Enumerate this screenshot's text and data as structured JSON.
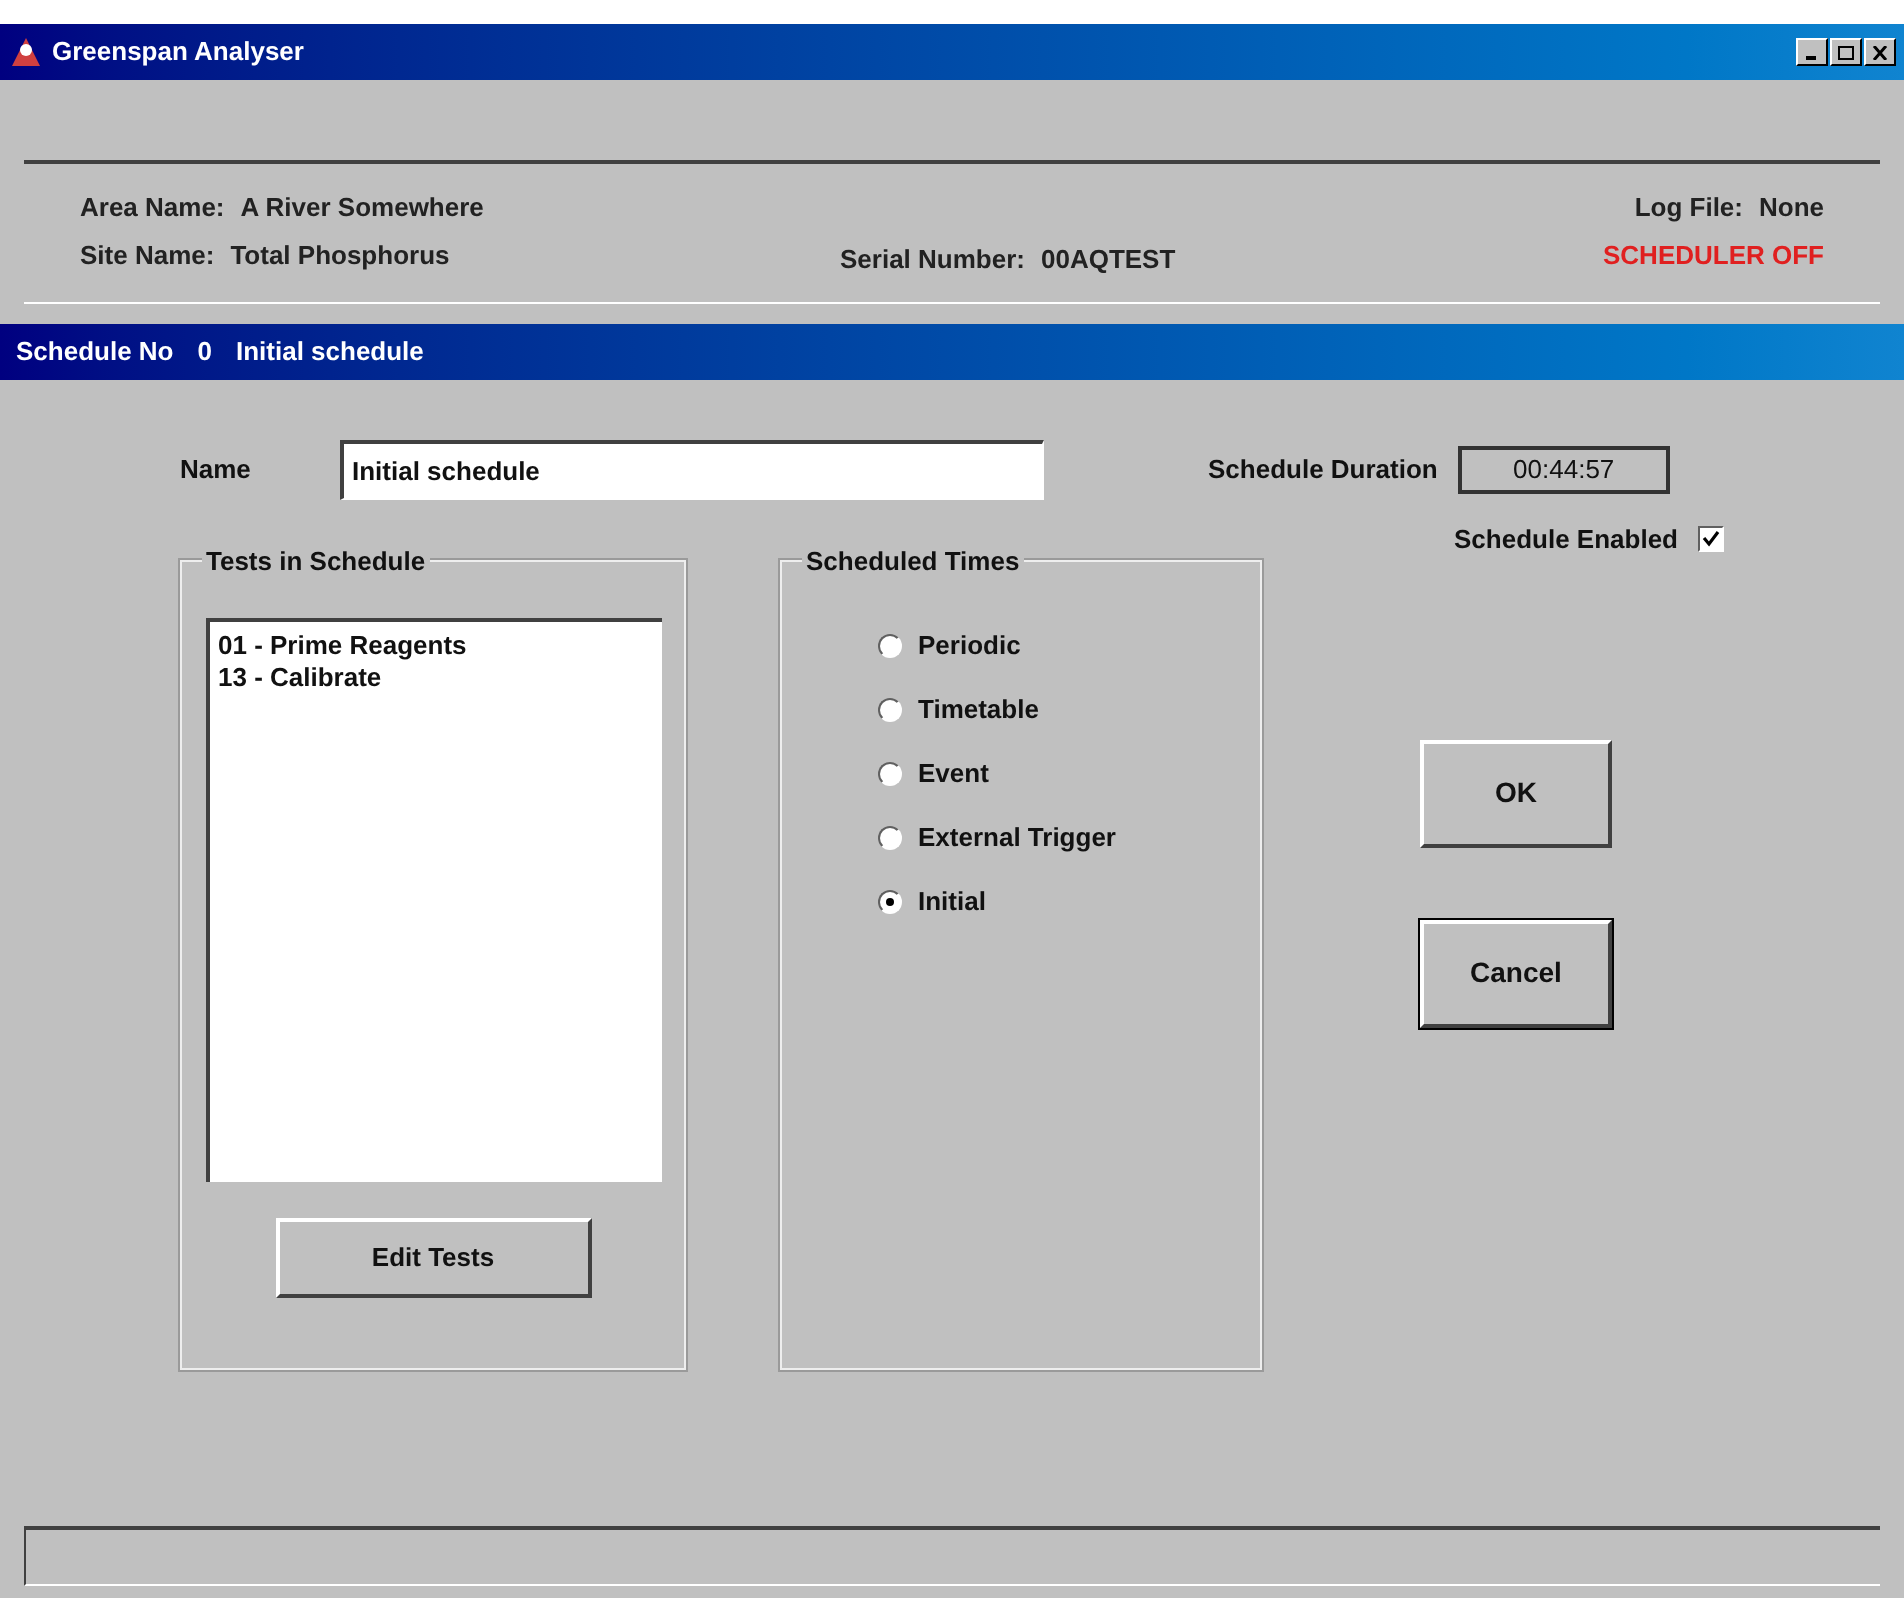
{
  "window": {
    "title": "Greenspan Analyser"
  },
  "header": {
    "area_label": "Area Name:",
    "area_value": "A River Somewhere",
    "site_label": "Site  Name:",
    "site_value": "Total Phosphorus",
    "serial_label": "Serial Number:",
    "serial_value": "00AQTEST",
    "log_label": "Log File:",
    "log_value": "None",
    "scheduler_status": "SCHEDULER OFF"
  },
  "schedule_bar": {
    "number_label": "Schedule No",
    "number": "0",
    "name": "Initial schedule"
  },
  "name_field": {
    "label": "Name",
    "value": "Initial schedule"
  },
  "duration": {
    "label": "Schedule Duration",
    "value": "00:44:57"
  },
  "enabled": {
    "label": "Schedule Enabled",
    "checked": true
  },
  "tests_group": {
    "title": "Tests in Schedule",
    "items": [
      "01 - Prime Reagents",
      "13 - Calibrate"
    ],
    "button": "Edit Tests"
  },
  "times_group": {
    "title": "Scheduled Times",
    "options": [
      {
        "label": "Periodic",
        "selected": false
      },
      {
        "label": "Timetable",
        "selected": false
      },
      {
        "label": "Event",
        "selected": false
      },
      {
        "label": "External Trigger",
        "selected": false
      },
      {
        "label": "Initial",
        "selected": true
      }
    ]
  },
  "buttons": [
    {
      "label": "OK",
      "default": false
    },
    {
      "label": "Cancel",
      "default": true
    }
  ]
}
